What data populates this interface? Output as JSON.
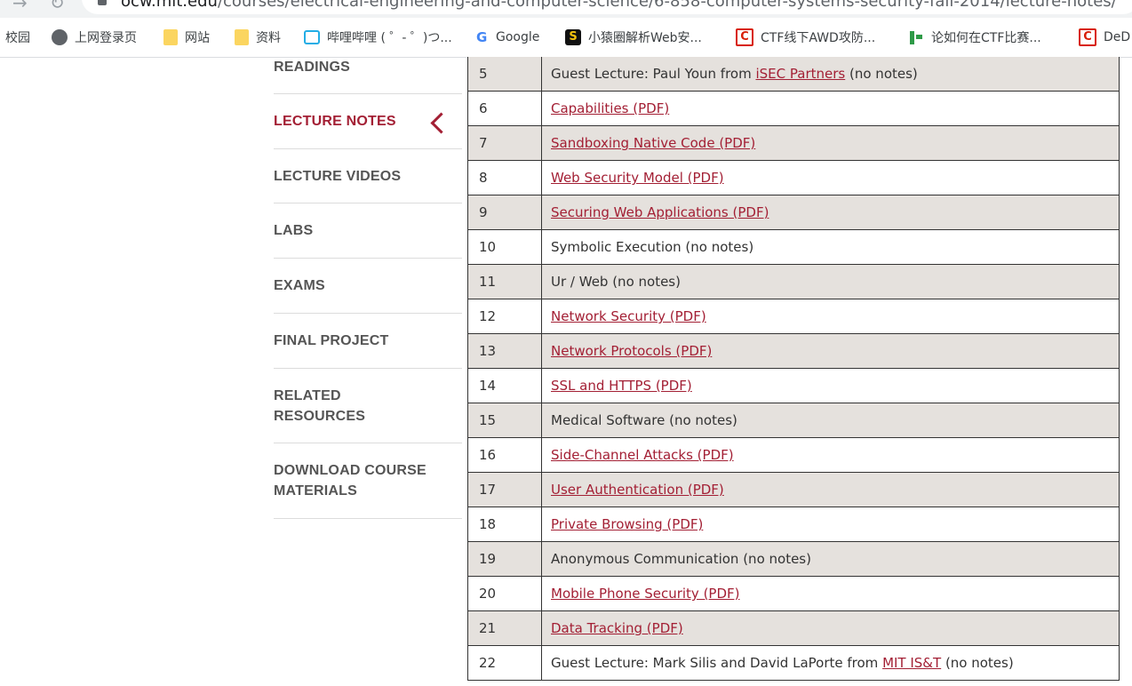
{
  "browser": {
    "url_host": "ocw.mit.edu",
    "url_path": "/courses/electrical-engineering-and-computer-science/6-858-computer-systems-security-fall-2014/lecture-notes/",
    "bookmarks": [
      {
        "label": "校园",
        "icon": "none"
      },
      {
        "label": "上网登录页",
        "icon": "globe-icon"
      },
      {
        "label": "网站",
        "icon": "folder-icon"
      },
      {
        "label": "资料",
        "icon": "folder-icon"
      },
      {
        "label": "哔哩哔哩 ( ゜- ゜)つ...",
        "icon": "bilibili-icon"
      },
      {
        "label": "Google",
        "icon": "google-icon"
      },
      {
        "label": "小猿圈解析Web安...",
        "icon": "xiaoyuanquan-icon"
      },
      {
        "label": "CTF线下AWD攻防...",
        "icon": "csdn-icon"
      },
      {
        "label": "论如何在CTF比赛...",
        "icon": "lunru-icon"
      },
      {
        "label": "DeD",
        "icon": "csdn-icon"
      }
    ]
  },
  "sidebar": {
    "items": [
      {
        "label": "READINGS"
      },
      {
        "label": "LECTURE NOTES",
        "active": true
      },
      {
        "label": "LECTURE VIDEOS"
      },
      {
        "label": "LABS"
      },
      {
        "label": "EXAMS"
      },
      {
        "label": "FINAL PROJECT"
      },
      {
        "label": "RELATED",
        "label2": "RESOURCES"
      },
      {
        "label": "DOWNLOAD COURSE",
        "label2": "MATERIALS"
      }
    ],
    "active_color": "#a31f34"
  },
  "table": {
    "rows": [
      {
        "num": "5",
        "pre": "Guest Lecture: Paul Youn from ",
        "link": "iSEC Partners",
        "post": " (no notes)"
      },
      {
        "num": "6",
        "pre": "",
        "link": "Capabilities (PDF)",
        "post": ""
      },
      {
        "num": "7",
        "pre": "",
        "link": "Sandboxing Native Code (PDF)",
        "post": ""
      },
      {
        "num": "8",
        "pre": "",
        "link": "Web Security Model (PDF)",
        "post": ""
      },
      {
        "num": "9",
        "pre": "",
        "link": "Securing Web Applications (PDF)",
        "post": ""
      },
      {
        "num": "10",
        "pre": "Symbolic Execution (no notes)",
        "link": "",
        "post": ""
      },
      {
        "num": "11",
        "pre": "Ur / Web (no notes)",
        "link": "",
        "post": ""
      },
      {
        "num": "12",
        "pre": "",
        "link": "Network Security (PDF)",
        "post": ""
      },
      {
        "num": "13",
        "pre": "",
        "link": "Network Protocols (PDF)",
        "post": ""
      },
      {
        "num": "14",
        "pre": "",
        "link": "SSL and HTTPS (PDF)",
        "post": ""
      },
      {
        "num": "15",
        "pre": "Medical Software (no notes)",
        "link": "",
        "post": ""
      },
      {
        "num": "16",
        "pre": "",
        "link": "Side-Channel Attacks (PDF)",
        "post": ""
      },
      {
        "num": "17",
        "pre": "",
        "link": "User Authentication (PDF)",
        "post": ""
      },
      {
        "num": "18",
        "pre": "",
        "link": "Private Browsing (PDF)",
        "post": ""
      },
      {
        "num": "19",
        "pre": "Anonymous Communication (no notes)",
        "link": "",
        "post": ""
      },
      {
        "num": "20",
        "pre": "",
        "link": "Mobile Phone Security (PDF)",
        "post": ""
      },
      {
        "num": "21",
        "pre": "",
        "link": "Data Tracking (PDF)",
        "post": ""
      },
      {
        "num": "22",
        "pre": "Guest Lecture: Mark Silis and David LaPorte from ",
        "link": "MIT IS&T",
        "post": " (no notes)"
      }
    ],
    "shade_color": "#e5e1dd",
    "link_color": "#a31f34"
  }
}
